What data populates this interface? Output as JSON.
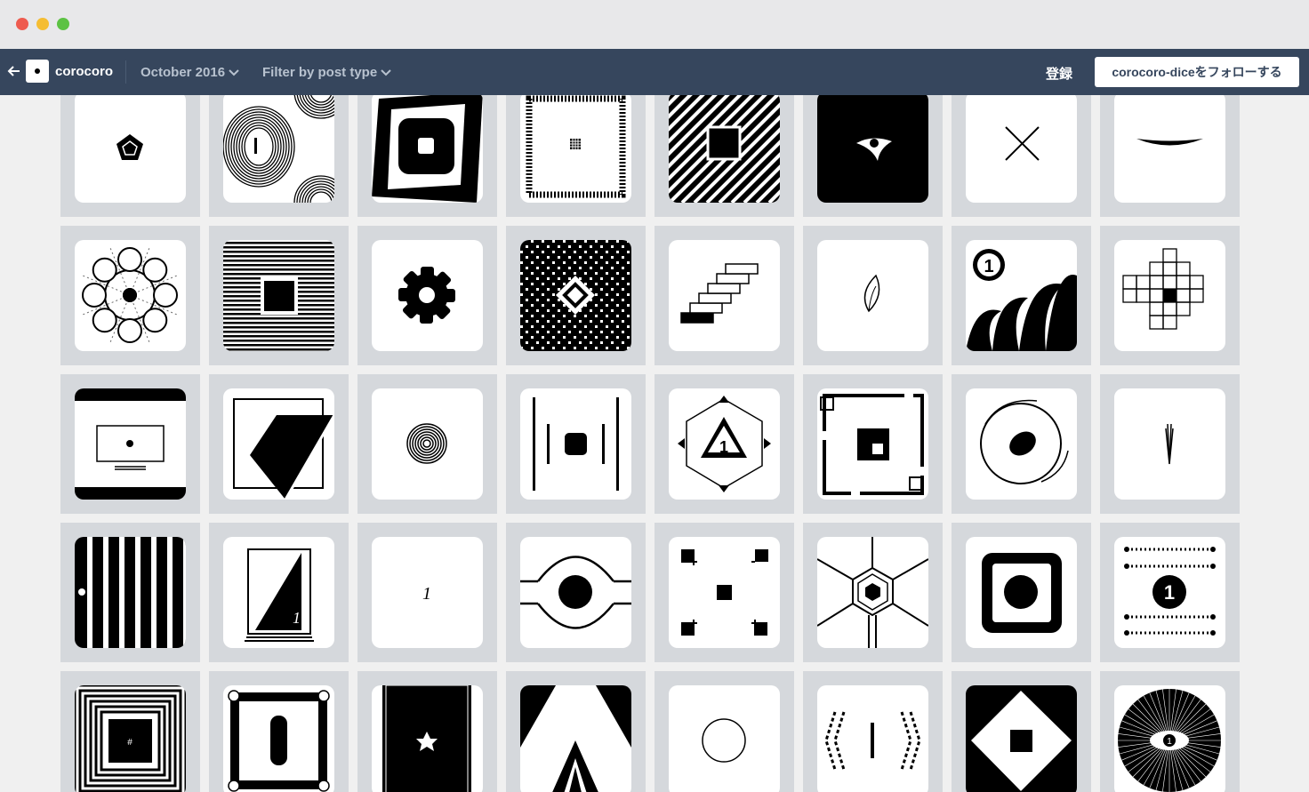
{
  "window": {
    "traffic_lights": [
      "close",
      "minimize",
      "zoom"
    ]
  },
  "topbar": {
    "back_icon": "arrow-left-icon",
    "blog_name": "corocoro",
    "month_menu": "October 2016",
    "filter_menu": "Filter by post type",
    "register": "登録",
    "follow_button": "corocoro-diceをフォローする",
    "colors": {
      "bar": "#36465d",
      "muted_text": "#b8c2cf"
    }
  },
  "grid": {
    "columns": 8,
    "rows": 5,
    "cell_background": "#d5d8dc",
    "posts": [
      "pentagon-icon",
      "concentric-rings-icon",
      "tilted-square-icon",
      "dotted-frame-icon",
      "diagonal-stripes-icon",
      "eye-black-icon",
      "x-mark-icon",
      "horizontal-lens-icon",
      "flower-circles-icon",
      "horizontal-lines-square-icon",
      "gear-icon",
      "checker-diamond-icon",
      "stairs-icon",
      "leaf-icon",
      "waves-one-icon",
      "cross-blocks-icon",
      "monitor-icon",
      "parallelogram-icon",
      "spiral-icon",
      "vertical-bars-icon",
      "hexagon-triangle-icon",
      "square-frame-icon",
      "orbit-circle-icon",
      "brush-stroke-icon",
      "vertical-stripes-icon",
      "triangle-card-icon",
      "dot-pattern-icon",
      "circle-arc-icon",
      "corner-marks-icon",
      "hexagon-lines-icon",
      "rounded-square-dot-icon",
      "dotted-lines-one-icon",
      "nested-rectangles-icon",
      "frame-pill-icon",
      "star-panel-icon",
      "triangle-a-icon",
      "circle-outline-icon",
      "zigzag-diamond-icon",
      "diamond-square-icon",
      "radial-eye-icon"
    ]
  }
}
